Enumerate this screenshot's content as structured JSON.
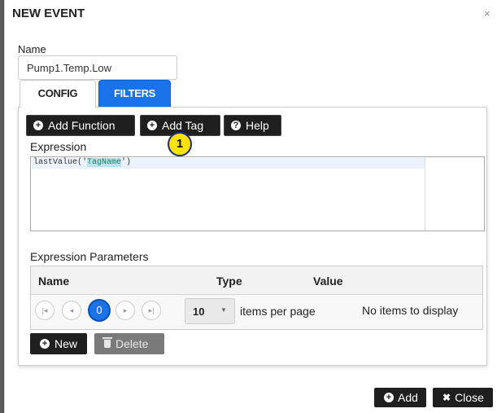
{
  "dialog": {
    "title": "NEW EVENT",
    "close_glyph": "×"
  },
  "name": {
    "label": "Name",
    "value": "Pump1.Temp.Low"
  },
  "tabs": [
    {
      "label": "CONFIG",
      "active": true
    },
    {
      "label": "FILTERS",
      "active": false,
      "color": "#1a73e8"
    }
  ],
  "toolbar": {
    "add_function": "Add Function",
    "add_tag": "Add Tag",
    "help": "Help"
  },
  "callout": {
    "number": "1",
    "color": "#ffe200"
  },
  "expression": {
    "label": "Expression",
    "code_prefix": "lastValue('",
    "code_highlight": "TagName",
    "code_suffix": "')"
  },
  "params": {
    "label": "Expression Parameters",
    "columns": [
      "Name",
      "Type",
      "Value"
    ],
    "rows": [],
    "pager": {
      "current_page": "0",
      "page_size": "10",
      "items_per_page_label": "items per page",
      "empty_message": "No items to display"
    }
  },
  "actions": {
    "new": "New",
    "delete": "Delete"
  },
  "footer": {
    "add": "Add",
    "close": "Close"
  },
  "icons": {
    "add": "plus-circle-icon",
    "help": "question-circle-icon",
    "delete": "trash-icon",
    "close": "times-icon"
  }
}
